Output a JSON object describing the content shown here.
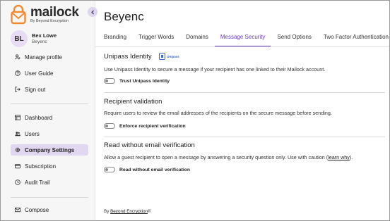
{
  "brand": {
    "name": "mailock",
    "tagline": "By Beyond Encryption"
  },
  "user": {
    "initials": "BL",
    "name": "Bex Lowe",
    "org": "Beyenc"
  },
  "sidebar": {
    "account": [
      {
        "label": "Manage profile",
        "icon": "profile-icon"
      },
      {
        "label": "User Guide",
        "icon": "help-icon"
      },
      {
        "label": "Sign out",
        "icon": "signout-icon"
      }
    ],
    "main": [
      {
        "label": "Dashboard",
        "icon": "dashboard-icon"
      },
      {
        "label": "Users",
        "icon": "users-icon"
      },
      {
        "label": "Company Settings",
        "icon": "settings-icon",
        "active": true
      },
      {
        "label": "Subscription",
        "icon": "subscription-icon"
      },
      {
        "label": "Audit Trail",
        "icon": "audit-icon"
      }
    ],
    "compose": {
      "label": "Compose",
      "icon": "compose-icon"
    }
  },
  "page": {
    "title": "Beyenc",
    "tabs": [
      "Branding",
      "Trigger Words",
      "Domains",
      "Message Security",
      "Send Options",
      "Two Factor Authentication"
    ],
    "active_tab": "Message Security"
  },
  "sections": {
    "unipass": {
      "title": "Unipass Identity",
      "badge": "Unipass",
      "description": "Use Unipass Identity to secure a message if your recipient has one linked to their Mailock account.",
      "toggle_label": "Trust Unipass Identity",
      "enabled": false
    },
    "recipient": {
      "title": "Recipient validation",
      "description": "Require users to review the email addresses of the recipients on the secure message before sending.",
      "toggle_label": "Enforce recipient verification",
      "enabled": false
    },
    "read_without": {
      "title": "Read without email verification",
      "description": "Allow a guest recipient to open a message by answering a security question only. Use with caution (",
      "link": "learn why",
      "description_end": ").",
      "toggle_label": "Read without email verification",
      "enabled": false
    }
  },
  "footer": {
    "prefix": "By ",
    "link": "Beyond Encryption",
    "suffix": "®"
  },
  "colors": {
    "accent": "#6a3bbf",
    "active_bg": "#e2d7f0",
    "logo": "#f28b30"
  }
}
